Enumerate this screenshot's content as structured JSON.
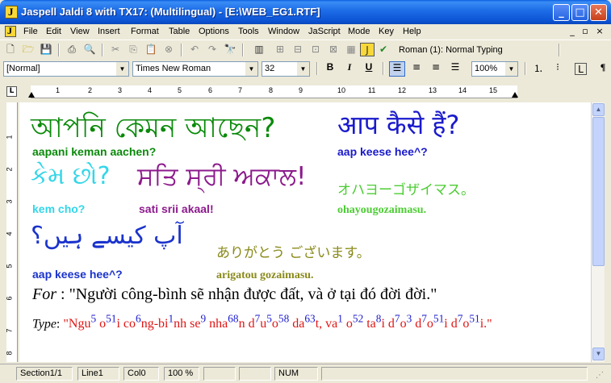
{
  "window": {
    "title": "Jaspell Jaldi 8 with TX17: (Multilingual) - [E:\\WEB_EG1.RTF]",
    "minimize": "_",
    "maximize": "□",
    "close": "✕"
  },
  "menu": {
    "items": [
      "File",
      "Edit",
      "View",
      "Insert",
      "Format",
      "Table",
      "Options",
      "Tools",
      "Window",
      "JaScript",
      "Mode",
      "Key",
      "Help"
    ],
    "mdi_minimize": "_",
    "mdi_restore": "▫",
    "mdi_close": "×"
  },
  "toolbar": {
    "mode_text": "Roman (1): Normal Typing"
  },
  "format_bar": {
    "style": "[Normal]",
    "font": "Times New Roman",
    "size": "32",
    "bold": "B",
    "italic": "I",
    "underline": "U",
    "zoom": "100%"
  },
  "ruler": {
    "numbers": [
      "1",
      "2",
      "3",
      "4",
      "5",
      "6",
      "7",
      "8",
      "9",
      "10",
      "11",
      "12",
      "13",
      "14",
      "15"
    ],
    "vnumbers": [
      "1",
      "2",
      "3",
      "4",
      "5",
      "6",
      "7",
      "8"
    ]
  },
  "document": {
    "bengali": "আপনি কেমন আছেন?",
    "hindi": "आप कैसे हैं?",
    "bengali_translit": "aapani keman aachen?",
    "hindi_translit": "aap keese hee^?",
    "gujarati": "કેમ છો?",
    "punjabi": "ਸਤਿ ਸ੍ਰੀ ਅਕਾਲ!",
    "japanese1": "オハヨーゴザイマス。",
    "gujarati_translit": "kem cho?",
    "punjabi_translit": "sati srii akaal!",
    "japanese1_translit": "ohayougozaimasu.",
    "urdu": "آپ کیسے ہیں؟",
    "japanese2": "ありがとう ございます。",
    "urdu_translit": "aap keese hee^?",
    "japanese2_translit": "arigatou gozaimasu.",
    "for_label": "For",
    "for_colon": " : ",
    "vietnamese": "\"Người công-bình sẽ nhận được đất, và ở tại đó đời đời.\"",
    "type_label": "Type",
    "type_colon": ": ",
    "typed_open_quote": "\"",
    "typed_close_quote": "\""
  },
  "status": {
    "section": "Section1/1",
    "line": "Line1",
    "col": "Col0",
    "zoom": "100 %",
    "num": "NUM"
  },
  "colors": {
    "bengali": "#0a8a0a",
    "hindi": "#1a1acc",
    "gujarati": "#33d6e8",
    "punjabi": "#8c1a8c",
    "japanese1": "#4ccc33",
    "urdu": "#1a33cc",
    "japanese2": "#8a8a1a",
    "type_red": "#e01414",
    "type_blue": "#1a1acc"
  }
}
